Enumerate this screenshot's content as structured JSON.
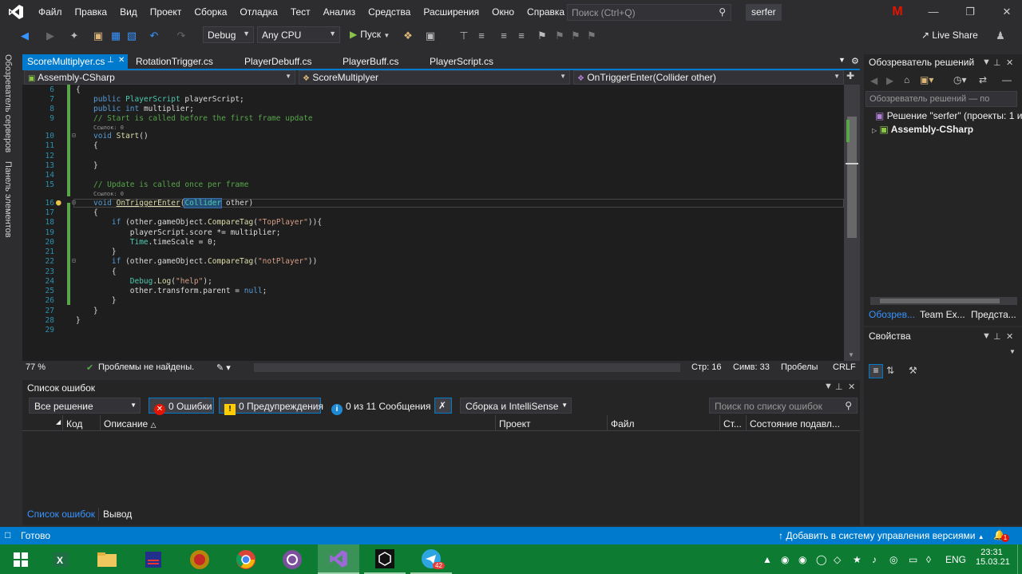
{
  "menu": [
    "Файл",
    "Правка",
    "Вид",
    "Проект",
    "Сборка",
    "Отладка",
    "Тест",
    "Анализ",
    "Средства",
    "Расширения",
    "Окно",
    "Справка"
  ],
  "search": {
    "placeholder": "Поиск (Ctrl+Q)"
  },
  "solution_name": "serfer",
  "user_initial": "M",
  "toolbar": {
    "config": "Debug",
    "platform": "Any CPU",
    "run_label": "Пуск",
    "live_share": "Live Share"
  },
  "left_tabs": [
    "Обозреватель серверов",
    "Панель элементов"
  ],
  "doc_tabs": [
    "ScoreMultiplyer.cs",
    "RotationTrigger.cs",
    "PlayerDebuff.cs",
    "PlayerBuff.cs",
    "PlayerScript.cs"
  ],
  "nav": {
    "project": "Assembly-CSharp",
    "class": "ScoreMultiplyer",
    "member": "OnTriggerEnter(Collider other)"
  },
  "code": {
    "refs_label": "Ссылок: 0"
  },
  "editor_status": {
    "zoom": "77 %",
    "issues": "Проблемы не найдены.",
    "line": "Стр: 16",
    "col": "Симв: 33",
    "spaces": "Пробелы",
    "eol": "CRLF"
  },
  "error_list": {
    "title": "Список ошибок",
    "scope": "Все решение",
    "errors": "0 Ошибки",
    "warnings": "0 Предупреждения",
    "messages": "0 из 11 Сообщения",
    "build_source": "Сборка и IntelliSense",
    "search_placeholder": "Поиск по списку ошибок",
    "columns": [
      "Код",
      "Описание",
      "Проект",
      "Файл",
      "Ст...",
      "Состояние подавл..."
    ],
    "footer_tabs": [
      "Список ошибок",
      "Вывод"
    ]
  },
  "solution_explorer": {
    "title": "Обозреватель решений",
    "search_placeholder": "Обозреватель решений — по",
    "solution_item": "Решение \"serfer\" (проекты: 1 из",
    "project_item": "Assembly-CSharp",
    "bottom_tabs": [
      "Обозрев...",
      "Team Ex...",
      "Предста..."
    ]
  },
  "properties": {
    "title": "Свойства"
  },
  "status": {
    "ready": "Готово",
    "vcs": "Добавить в систему управления версиями",
    "notif_count": "1"
  },
  "taskbar": {
    "lang": "ENG",
    "time": "23:31",
    "date": "15.03.21",
    "telegram_badge": "42"
  },
  "colors": {
    "accent": "#007acc",
    "taskbar": "#0d7c32",
    "editor_bg": "#1e1e1e"
  }
}
